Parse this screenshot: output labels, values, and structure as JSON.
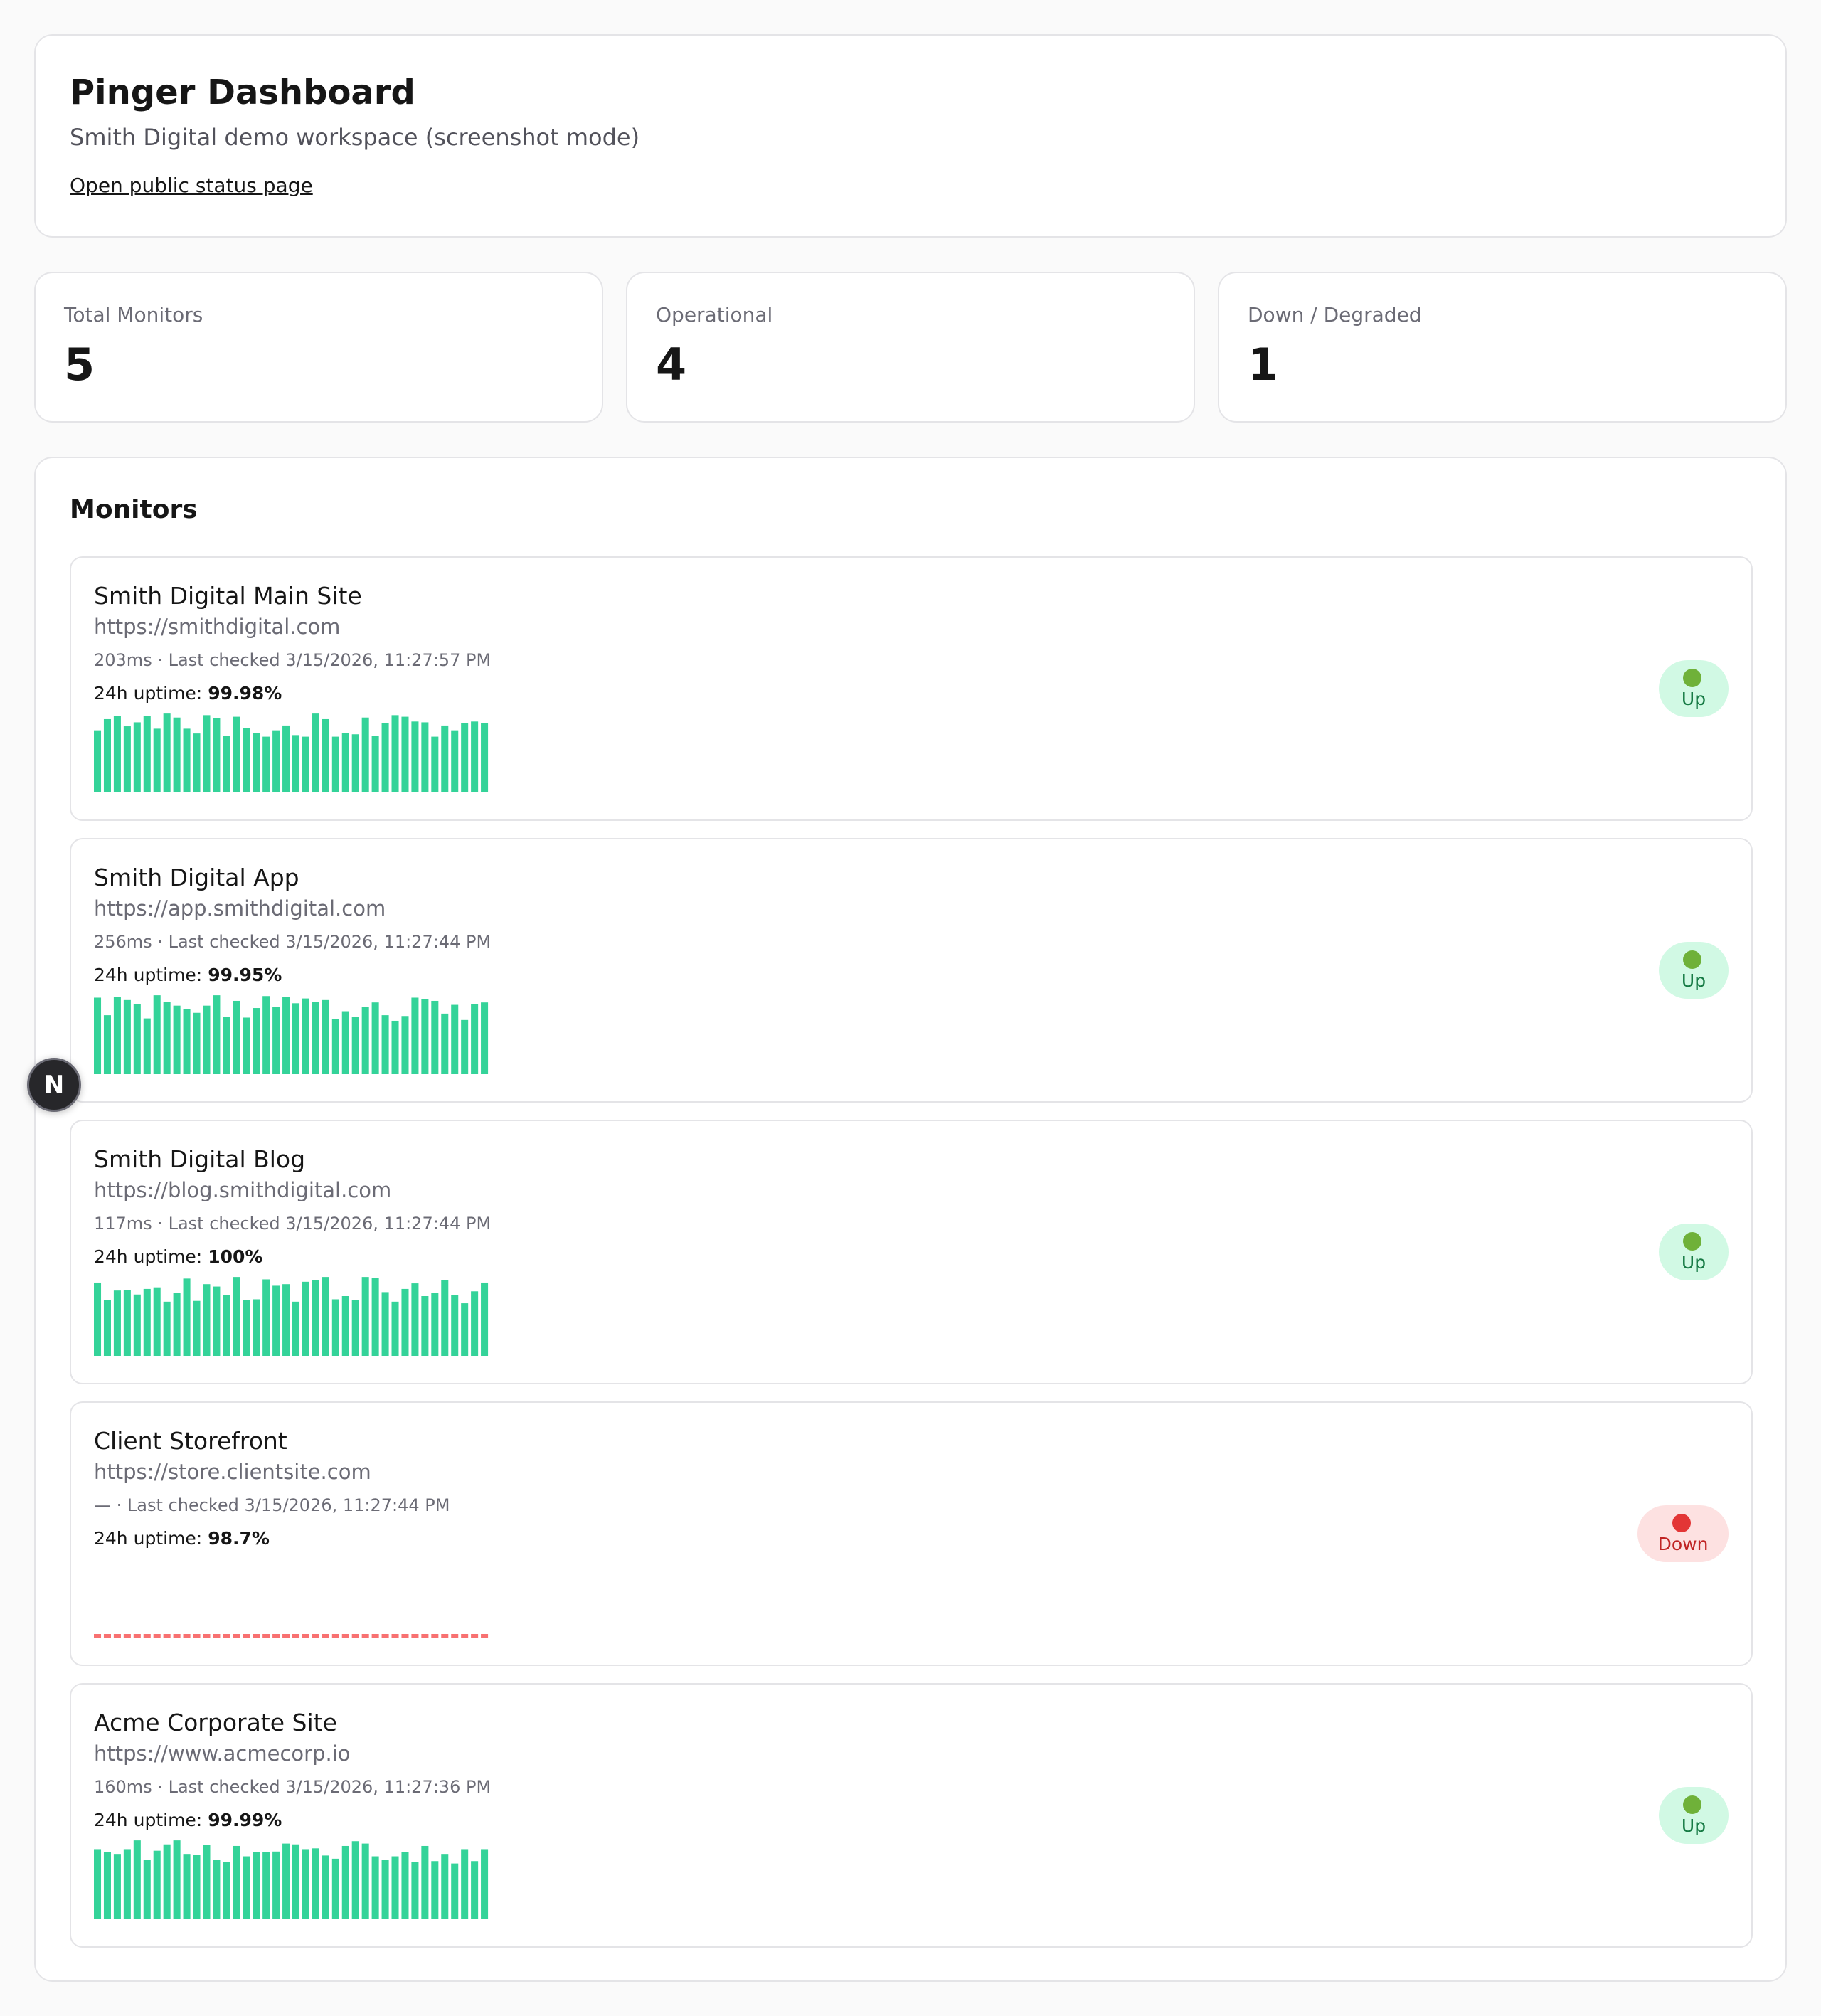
{
  "header": {
    "title": "Pinger Dashboard",
    "subtitle": "Smith Digital demo workspace (screenshot mode)",
    "public_link": "Open public status page"
  },
  "stats": [
    {
      "label": "Total Monitors",
      "value": "5"
    },
    {
      "label": "Operational",
      "value": "4"
    },
    {
      "label": "Down / Degraded",
      "value": "1"
    }
  ],
  "monitors_title": "Monitors",
  "uptime_label": "24h uptime:",
  "colors": {
    "bar_up": "#34d399",
    "bar_down": "#f87171",
    "badge_up_bg": "#d1f9e4",
    "badge_down_bg": "#fde1e1"
  },
  "monitors": [
    {
      "name": "Smith Digital Main Site",
      "url": "https://smithdigital.com",
      "meta": "203ms · Last checked 3/15/2026, 11:27:57 PM",
      "uptime": "99.98%",
      "status": "Up",
      "status_type": "up",
      "history": [
        0.78,
        0.92,
        0.96,
        0.83,
        0.88,
        0.96,
        0.8,
        0.99,
        0.94,
        0.8,
        0.74,
        0.97,
        0.93,
        0.71,
        0.95,
        0.81,
        0.75,
        0.7,
        0.78,
        0.84,
        0.72,
        0.7,
        0.99,
        0.92,
        0.7,
        0.75,
        0.73,
        0.94,
        0.71,
        0.87,
        0.97,
        0.95,
        0.89,
        0.88,
        0.7,
        0.84,
        0.78,
        0.87,
        0.89,
        0.87
      ]
    },
    {
      "name": "Smith Digital App",
      "url": "https://app.smithdigital.com",
      "meta": "256ms · Last checked 3/15/2026, 11:27:44 PM",
      "uptime": "99.95%",
      "status": "Up",
      "status_type": "up",
      "history": [
        0.96,
        0.74,
        0.97,
        0.93,
        0.88,
        0.7,
        0.99,
        0.91,
        0.86,
        0.82,
        0.77,
        0.86,
        0.99,
        0.72,
        0.92,
        0.71,
        0.83,
        0.98,
        0.84,
        0.97,
        0.89,
        0.95,
        0.91,
        0.93,
        0.69,
        0.79,
        0.72,
        0.84,
        0.9,
        0.74,
        0.67,
        0.73,
        0.96,
        0.94,
        0.92,
        0.76,
        0.87,
        0.68,
        0.88,
        0.9
      ]
    },
    {
      "name": "Smith Digital Blog",
      "url": "https://blog.smithdigital.com",
      "meta": "117ms · Last checked 3/15/2026, 11:27:44 PM",
      "uptime": "100%",
      "status": "Up",
      "status_type": "up",
      "history": [
        0.92,
        0.7,
        0.82,
        0.83,
        0.77,
        0.84,
        0.86,
        0.68,
        0.79,
        0.97,
        0.69,
        0.9,
        0.87,
        0.76,
        0.99,
        0.7,
        0.71,
        0.96,
        0.88,
        0.9,
        0.68,
        0.93,
        0.95,
        0.99,
        0.71,
        0.75,
        0.7,
        0.99,
        0.98,
        0.8,
        0.68,
        0.84,
        0.91,
        0.75,
        0.79,
        0.95,
        0.76,
        0.66,
        0.81,
        0.92
      ]
    },
    {
      "name": "Client Storefront",
      "url": "https://store.clientsite.com",
      "meta": "— · Last checked 3/15/2026, 11:27:44 PM",
      "uptime": "98.7%",
      "status": "Down",
      "status_type": "down",
      "history": [
        0,
        0,
        0,
        0,
        0,
        0,
        0,
        0,
        0,
        0,
        0,
        0,
        0,
        0,
        0,
        0,
        0,
        0,
        0,
        0,
        0,
        0,
        0,
        0,
        0,
        0,
        0,
        0,
        0,
        0,
        0,
        0,
        0,
        0,
        0,
        0,
        0,
        0,
        0,
        0
      ]
    },
    {
      "name": "Acme Corporate Site",
      "url": "https://www.acmecorp.io",
      "meta": "160ms · Last checked 3/15/2026, 11:27:36 PM",
      "uptime": "99.99%",
      "status": "Up",
      "status_type": "up",
      "history": [
        0.88,
        0.84,
        0.82,
        0.88,
        0.99,
        0.75,
        0.86,
        0.94,
        0.99,
        0.82,
        0.81,
        0.93,
        0.75,
        0.72,
        0.92,
        0.79,
        0.84,
        0.84,
        0.85,
        0.95,
        0.94,
        0.88,
        0.89,
        0.8,
        0.76,
        0.92,
        0.98,
        0.95,
        0.79,
        0.75,
        0.79,
        0.84,
        0.72,
        0.92,
        0.73,
        0.82,
        0.7,
        0.88,
        0.73,
        0.88
      ]
    }
  ],
  "dev_badge": "N"
}
